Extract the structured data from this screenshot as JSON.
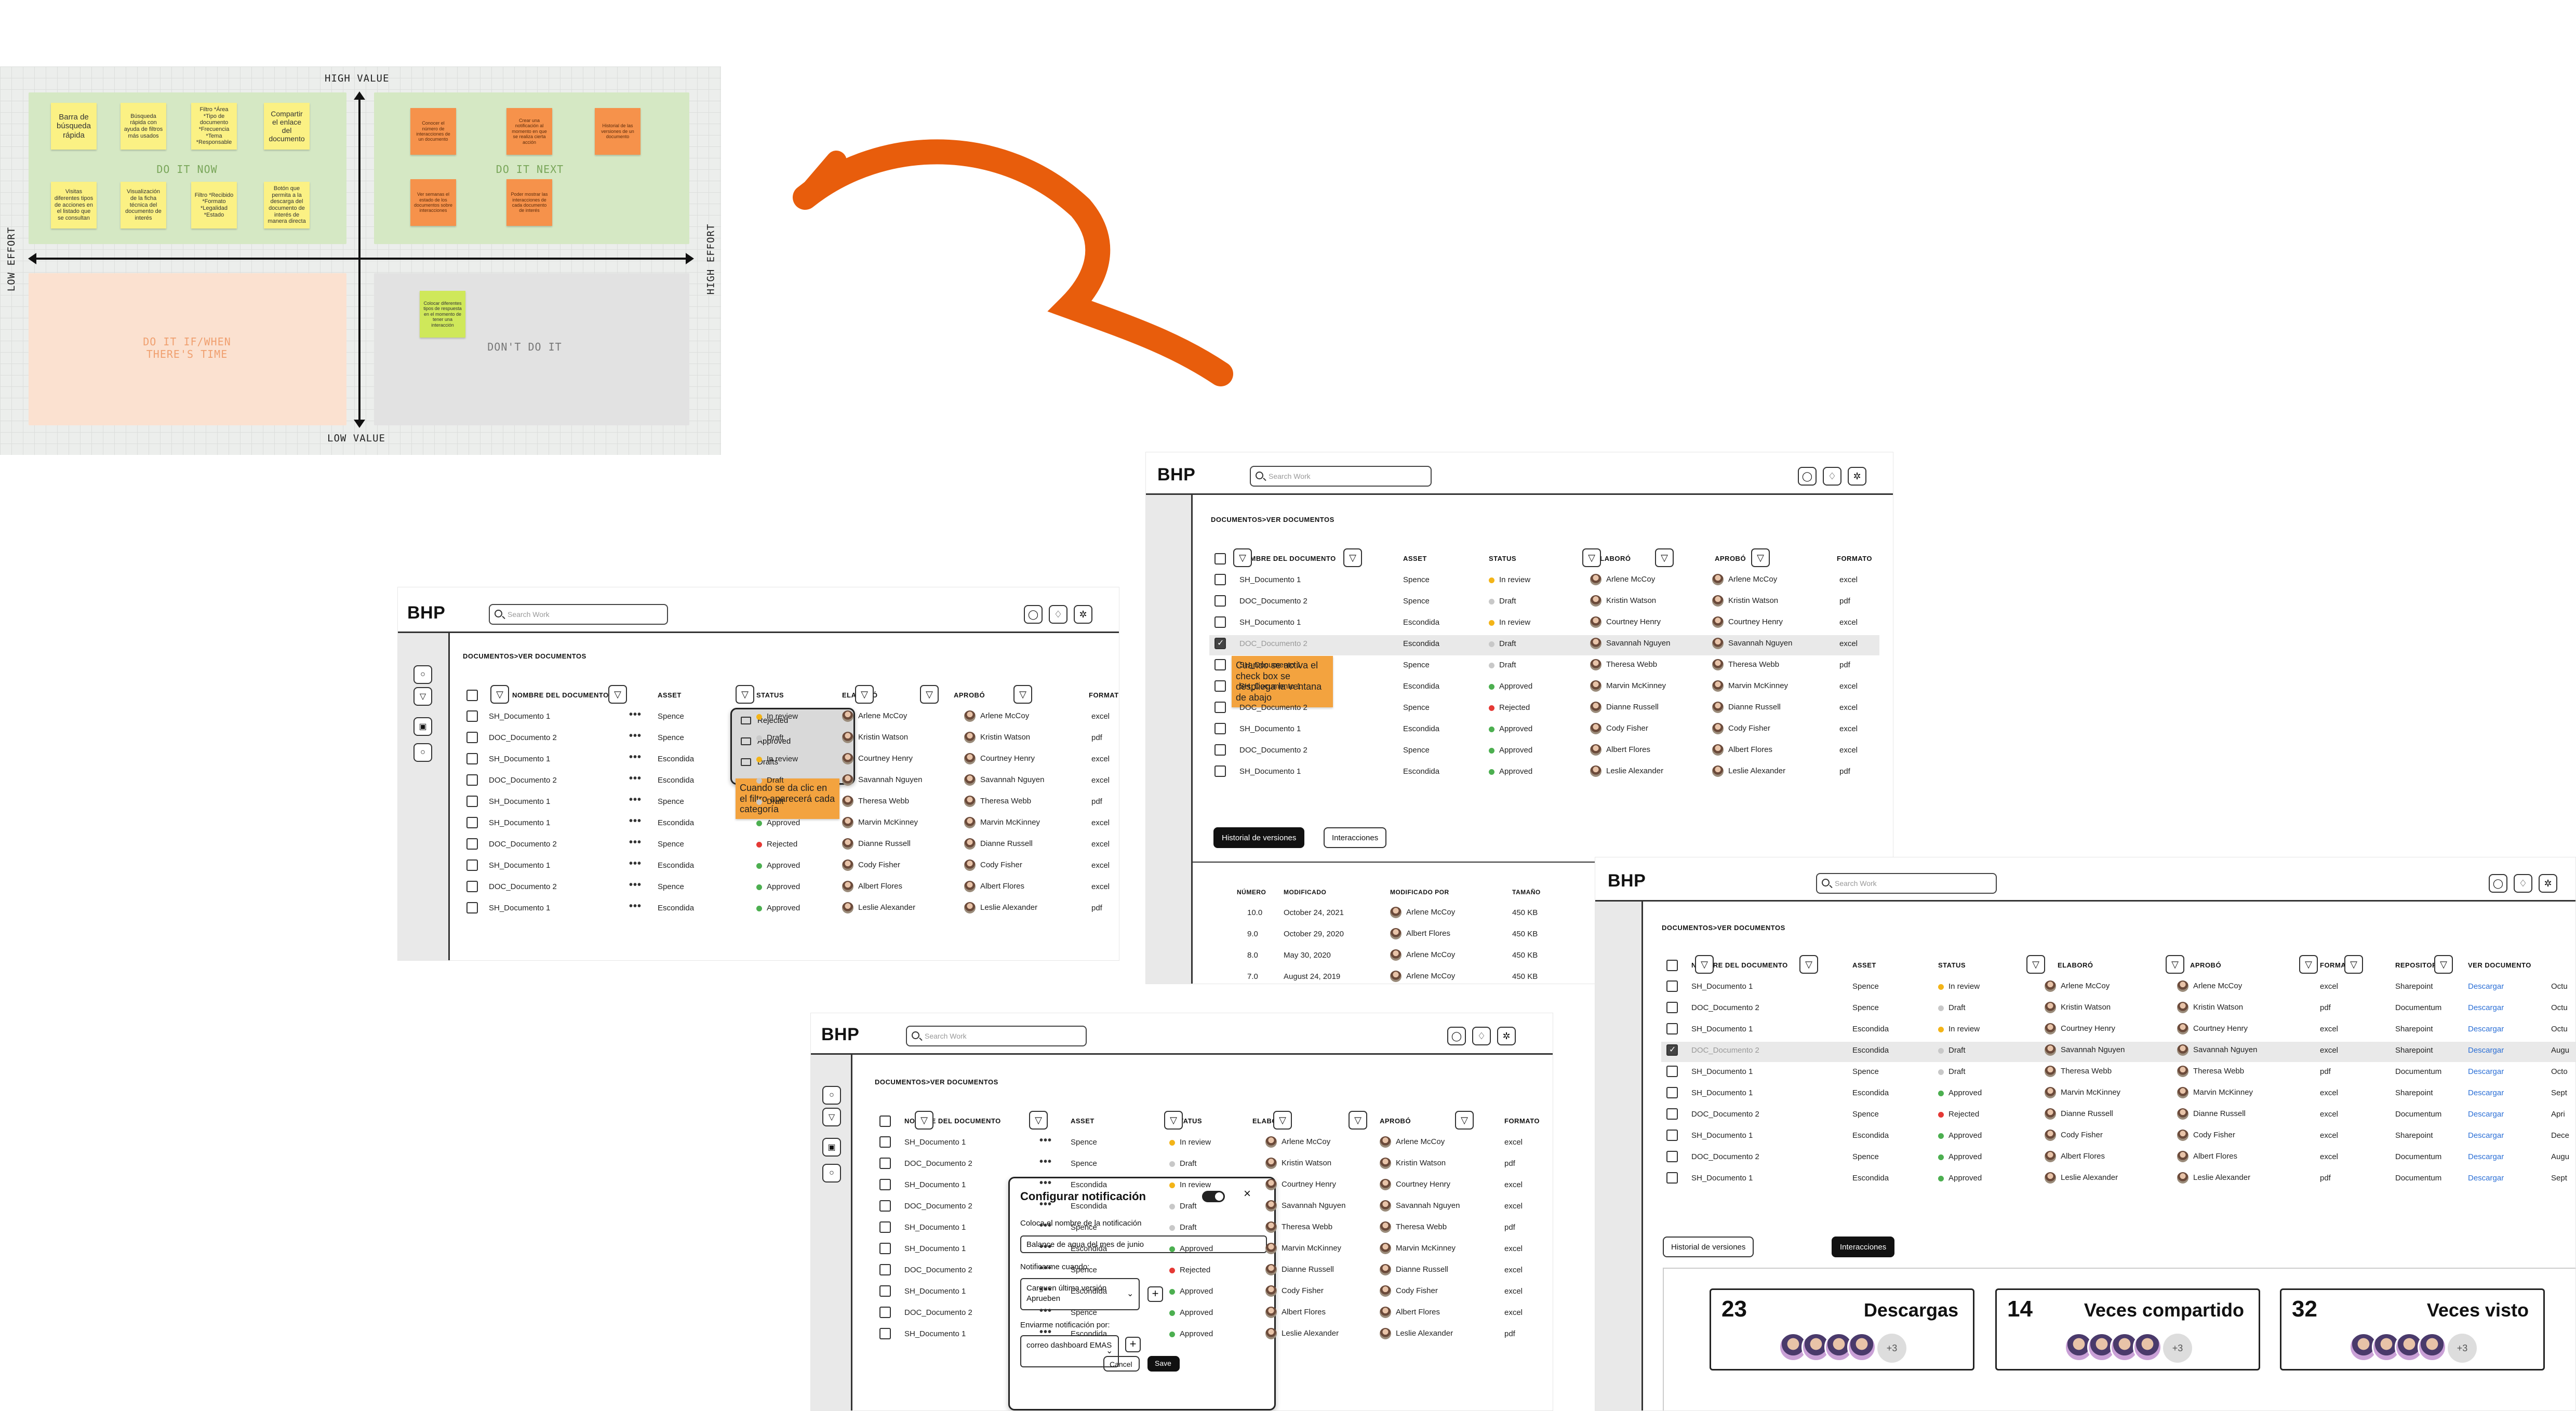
{
  "matrix": {
    "top_label": "HIGH VALUE",
    "bottom_label": "LOW VALUE",
    "left_label": "LOW EFFORT",
    "right_label": "HIGH EFFORT",
    "quadrants": {
      "do_it_now": "DO IT NOW",
      "do_it_next": "DO IT NEXT",
      "do_it_if": "DO IT IF/WHEN THERE'S TIME",
      "dont": "DON'T DO IT"
    },
    "notes_now": [
      "Barra de búsqueda rápida",
      "Búsqueda rápida con ayuda de filtros más usados",
      "Filtro *Área *Tipo de documento *Frecuencia *Tema *Responsable",
      "Compartir el enlace del documento",
      "Visitas diferentes tipos de acciones en el listado que se consultan",
      "Visualización de la ficha técnica del documento de interés",
      "Filtro *Recibido *Formato *Legalidad *Estado",
      "Botón que permita a la descarga del documento de interés de manera directa"
    ],
    "notes_next": [
      "Conocer el número de interacciones de un documento",
      "Crear una notificación al momento en que se realiza cierta acción",
      "Historial de las versiones de un documento",
      "Ver semanas el estado de los documentos sobre interacciones",
      "Poder mostrar las interacciones de cada documento de interés",
      "Ver el historial de cambios realizados en el documento"
    ],
    "notes_dont": [
      "Colocar diferentes tipos de respuesta en el momento de tener una interacción"
    ]
  },
  "app": {
    "brand": "BHP",
    "search_placeholder": "Search Work",
    "breadcrumb": "DOCUMENTOS>VER DOCUMENTOS",
    "cols": {
      "nombre": "NOMBRE DEL DOCUMENTO",
      "asset": "ASSET",
      "status": "STATUS",
      "elaboro": "ELABORÓ",
      "aprobo": "APROBÓ",
      "formato": "FORMATO",
      "repositorio": "REPOSITORIO",
      "ver": "VER DOCUMENTO",
      "octubre": "Octu"
    },
    "rows": [
      {
        "n": "SH_Documento 1",
        "a": "Spence",
        "s": "In review",
        "sc": "#f3b418",
        "e": "Arlene McCoy",
        "ap": "Arlene McCoy",
        "f": "excel",
        "r": "Sharepoint",
        "o": "Octu"
      },
      {
        "n": "DOC_Documento 2",
        "a": "Spence",
        "s": "Draft",
        "sc": "#c8c8c8",
        "e": "Kristin Watson",
        "ap": "Kristin Watson",
        "f": "pdf",
        "r": "Documentum",
        "o": "Octu"
      },
      {
        "n": "SH_Documento 1",
        "a": "Escondida",
        "s": "In review",
        "sc": "#f3b418",
        "e": "Courtney Henry",
        "ap": "Courtney Henry",
        "f": "excel",
        "r": "Sharepoint",
        "o": "Octu"
      },
      {
        "n": "DOC_Documento 2",
        "a": "Escondida",
        "s": "Draft",
        "sc": "#c8c8c8",
        "e": "Savannah Nguyen",
        "ap": "Savannah Nguyen",
        "f": "excel",
        "r": "Sharepoint",
        "o": "Augu"
      },
      {
        "n": "SH_Documento 1",
        "a": "Spence",
        "s": "Draft",
        "sc": "#c8c8c8",
        "e": "Theresa Webb",
        "ap": "Theresa Webb",
        "f": "pdf",
        "r": "Documentum",
        "o": "Octo"
      },
      {
        "n": "SH_Documento 1",
        "a": "Escondida",
        "s": "Approved",
        "sc": "#4caf50",
        "e": "Marvin McKinney",
        "ap": "Marvin McKinney",
        "f": "excel",
        "r": "Sharepoint",
        "o": "Sept"
      },
      {
        "n": "DOC_Documento 2",
        "a": "Spence",
        "s": "Rejected",
        "sc": "#e53935",
        "e": "Dianne Russell",
        "ap": "Dianne Russell",
        "f": "excel",
        "r": "Documentum",
        "o": "Apri"
      },
      {
        "n": "SH_Documento 1",
        "a": "Escondida",
        "s": "Approved",
        "sc": "#4caf50",
        "e": "Cody Fisher",
        "ap": "Cody Fisher",
        "f": "excel",
        "r": "Sharepoint",
        "o": "Dece"
      },
      {
        "n": "DOC_Documento 2",
        "a": "Spence",
        "s": "Approved",
        "sc": "#4caf50",
        "e": "Albert Flores",
        "ap": "Albert Flores",
        "f": "excel",
        "r": "Documentum",
        "o": "Augu"
      },
      {
        "n": "SH_Documento 1",
        "a": "Escondida",
        "s": "Approved",
        "sc": "#4caf50",
        "e": "Leslie Alexander",
        "ap": "Leslie Alexander",
        "f": "pdf",
        "r": "Documentum",
        "o": "Sept"
      }
    ],
    "download": "Descargar",
    "filter_popup": {
      "items": [
        "Rejected",
        "Approved",
        "Drafts"
      ]
    },
    "tip_filter": "Cuando se da clic en el filtro aparecerá cada categoría",
    "tip_check": "Cuando se activa el check box se despliega la ventana de abajo",
    "tabs": {
      "historial": "Historial de versiones",
      "interacciones": "Interacciones"
    },
    "history": {
      "cols": [
        "NÚMERO",
        "MODIFICADO",
        "MODIFICADO POR",
        "TAMAÑO"
      ],
      "rows": [
        [
          "10.0",
          "October 24, 2021",
          "Arlene McCoy",
          "450 KB"
        ],
        [
          "9.0",
          "October 29, 2020",
          "Albert Flores",
          "450 KB"
        ],
        [
          "8.0",
          "May 30, 2020",
          "Arlene McCoy",
          "450 KB"
        ],
        [
          "7.0",
          "August 24, 2019",
          "Arlene McCoy",
          "450 KB"
        ]
      ]
    },
    "stats": [
      {
        "n": "23",
        "label": "Descargas"
      },
      {
        "n": "14",
        "label": "Veces compartido"
      },
      {
        "n": "32",
        "label": "Veces visto"
      }
    ],
    "more": "+3",
    "modal": {
      "title": "Configurar notificación",
      "name_label": "Coloca el nombre de la notificación",
      "name_value": "Balance de agua del mes de junio",
      "notify_label": "Notificarme cuando:",
      "notify_value": "Carguen última versión Aprueben",
      "send_label": "Enviarme notificación por:",
      "send_value": "correo dashboard EMAS",
      "cancel": "Cancel",
      "save": "Save"
    }
  },
  "colors": {
    "arrow": "#e85d0c",
    "green_quad": "#d5e8c4",
    "orange_quad": "#fbe1d0",
    "grey_quad": "#e2e2e2"
  }
}
